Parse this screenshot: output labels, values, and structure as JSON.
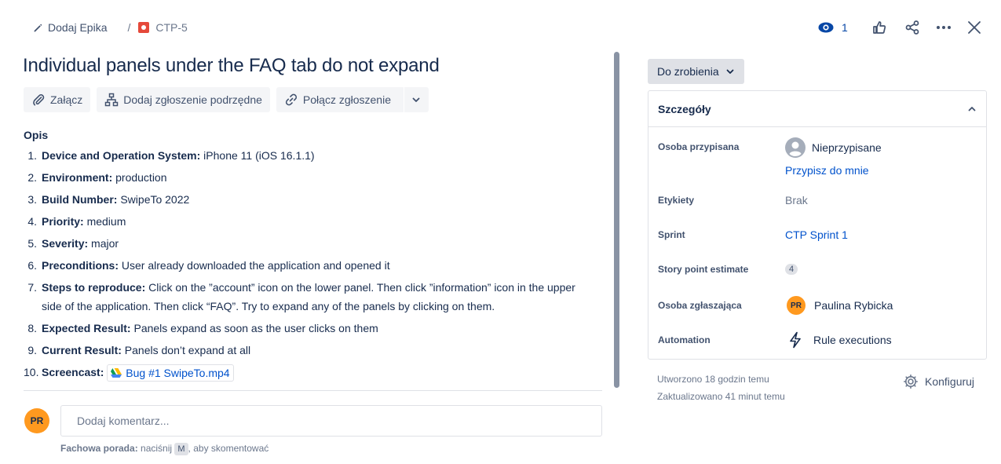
{
  "breadcrumb": {
    "epic_label": "Dodaj Epika",
    "separator": "/",
    "issue_key": "CTP-5"
  },
  "top_actions": {
    "watch_count": "1"
  },
  "issue": {
    "title": "Individual panels under the FAQ tab do not expand"
  },
  "toolbar": {
    "attach": "Załącz",
    "add_child": "Dodaj zgłoszenie podrzędne",
    "link_issue": "Połącz zgłoszenie"
  },
  "description": {
    "heading": "Opis",
    "items": [
      {
        "n": "1.",
        "label": "Device and Operation System:",
        "text": " iPhone 11 (iOS 16.1.1)"
      },
      {
        "n": "2.",
        "label": "Environment:",
        "text": " production"
      },
      {
        "n": "3.",
        "label": "Build Number:",
        "text": " SwipeTo 2022"
      },
      {
        "n": "4.",
        "label": "Priority:",
        "text": " medium"
      },
      {
        "n": "5.",
        "label": "Severity:",
        "text": " major"
      },
      {
        "n": "6.",
        "label": "Preconditions:",
        "text": " User already downloaded the application and opened it"
      },
      {
        "n": "7.",
        "label": "Steps to reproduce:",
        "text": " Click on the ”account” icon on the lower panel. Then click ”information” icon in the upper side of the application. Then click “FAQ”. Try to expand any of the panels by clicking on them."
      },
      {
        "n": "8.",
        "label": "Expected Result:",
        "text": " Panels expand as soon as the user clicks on them"
      },
      {
        "n": "9.",
        "label": "Current Result:",
        "text": " Panels don’t expand at all"
      },
      {
        "n": "10.",
        "label": "Screencast:",
        "text": " "
      }
    ],
    "attachment": "Bug #1 SwipeTo.mp4"
  },
  "comment": {
    "avatar_initials": "PR",
    "placeholder": "Dodaj komentarz...",
    "tip_bold": "Fachowa porada:",
    "tip_pre": " naciśnij ",
    "tip_key": "M",
    "tip_post": ", aby skomentować"
  },
  "status": {
    "label": "Do zrobienia"
  },
  "details": {
    "heading": "Szczegóły",
    "assignee_label": "Osoba przypisana",
    "assignee_value": "Nieprzypisane",
    "assign_to_me": "Przypisz do mnie",
    "labels_label": "Etykiety",
    "labels_value": "Brak",
    "sprint_label": "Sprint",
    "sprint_value": "CTP Sprint 1",
    "story_points_label": "Story point estimate",
    "story_points_value": "4",
    "reporter_label": "Osoba zgłaszająca",
    "reporter_initials": "PR",
    "reporter_value": "Paulina Rybicka",
    "automation_label": "Automation",
    "automation_value": "Rule executions"
  },
  "meta": {
    "created": "Utworzono 18 godzin temu",
    "updated": "Zaktualizowano 41 minut temu",
    "configure": "Konfiguruj"
  },
  "colors": {
    "link": "#0052cc",
    "bug_red": "#e5493a",
    "avatar_orange": "#ff991f",
    "watch_blue": "#0747a6"
  }
}
